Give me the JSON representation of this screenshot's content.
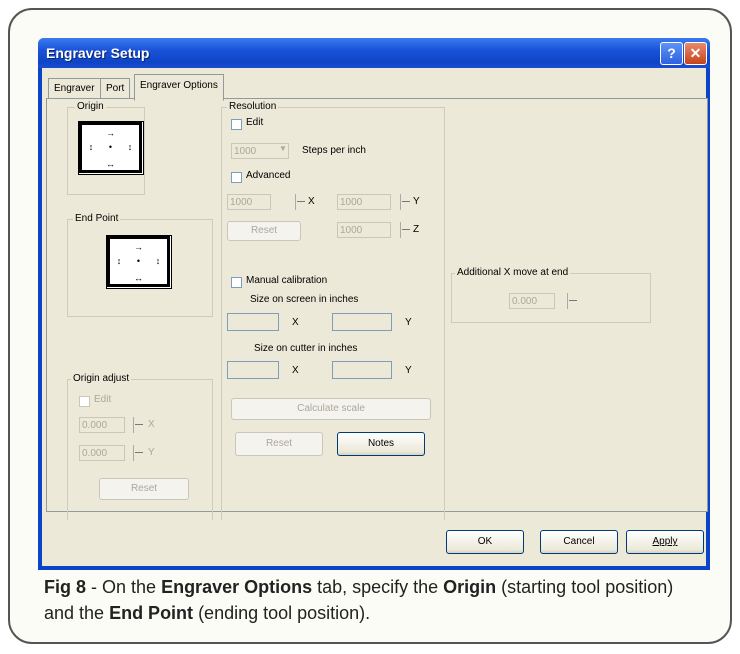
{
  "window": {
    "title": "Engraver Setup",
    "help_glyph": "?",
    "close_glyph": "✕"
  },
  "tabs": [
    "Engraver",
    "Port",
    "Engraver Options"
  ],
  "origin": {
    "label": "Origin"
  },
  "end_point": {
    "label": "End Point"
  },
  "origin_adjust": {
    "label": "Origin adjust",
    "edit_label": "Edit",
    "x_value": "0.000",
    "y_value": "0.000",
    "x_label": "X",
    "y_label": "Y",
    "reset_label": "Reset"
  },
  "resolution": {
    "label": "Resolution",
    "edit_label": "Edit",
    "steps_value": "1000",
    "steps_label": "Steps per inch",
    "advanced_label": "Advanced",
    "x_value": "1000",
    "y_value": "1000",
    "z_value": "1000",
    "x_label": "X",
    "y_label": "Y",
    "z_label": "Z",
    "reset_label": "Reset",
    "manual_calibration_label": "Manual calibration",
    "size_screen_label": "Size on screen in inches",
    "size_cutter_label": "Size on cutter in inches",
    "calculate_scale_label": "Calculate scale",
    "reset2_label": "Reset",
    "notes_label": "Notes"
  },
  "additional": {
    "label": "Additional X move at end",
    "value": "0.000"
  },
  "footer": {
    "ok": "OK",
    "cancel": "Cancel",
    "apply": "Apply"
  },
  "caption": {
    "fig": "Fig 8",
    "text_1": " - On the ",
    "bold_1": "Engraver Options",
    "text_2": " tab, specify the ",
    "bold_2": "Origin",
    "text_3": " (starting tool position) and the ",
    "bold_3": "End Point",
    "text_4": " (ending tool position)."
  }
}
